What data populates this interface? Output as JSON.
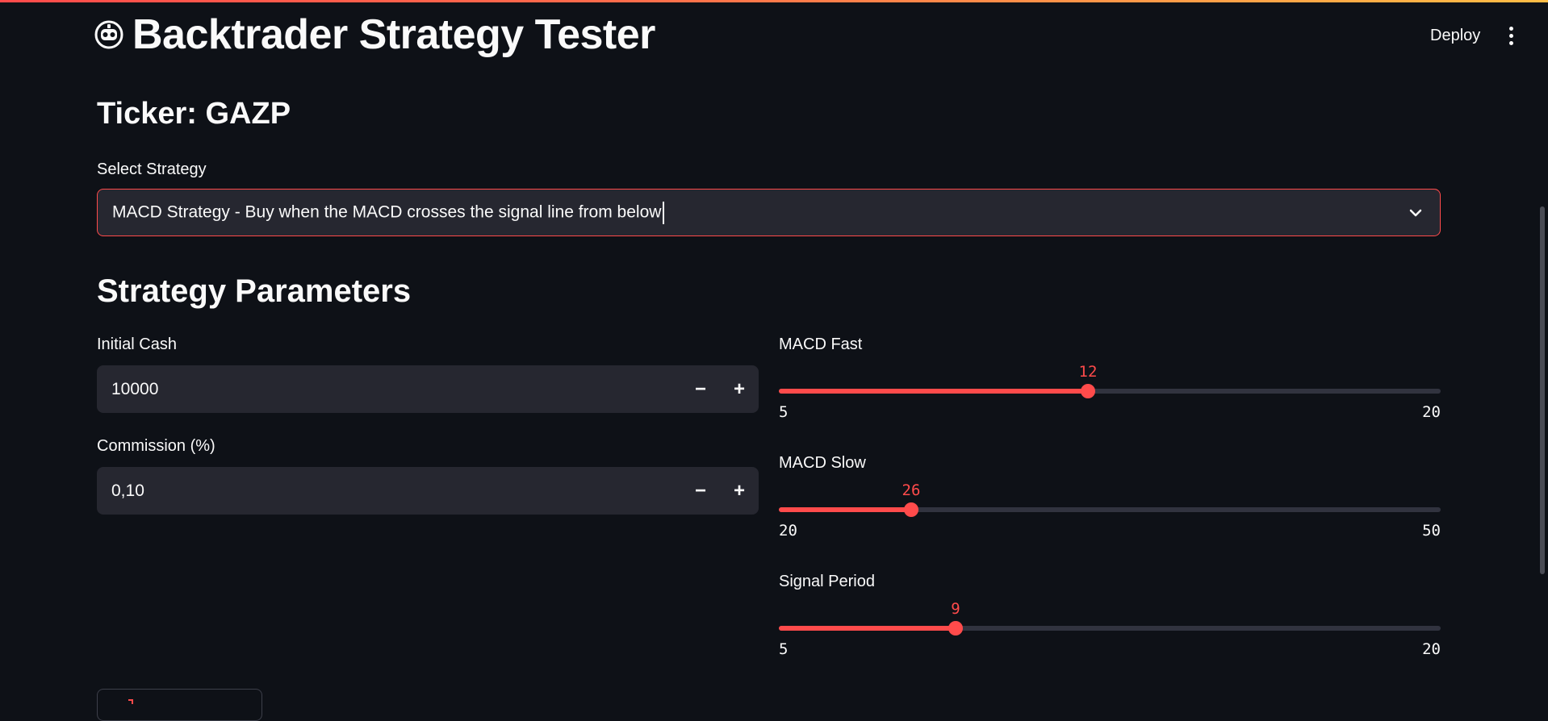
{
  "app": {
    "title": "Backtrader Strategy Tester",
    "icon": "robot-face-icon"
  },
  "header": {
    "deploy_label": "Deploy",
    "menu_icon": "vertical-ellipsis-icon"
  },
  "ticker": {
    "heading": "Ticker: GAZP"
  },
  "strategy_select": {
    "label": "Select Strategy",
    "value": "MACD Strategy - Buy when the MACD crosses the signal line from below",
    "icon": "chevron-down-icon"
  },
  "parameters": {
    "heading": "Strategy Parameters",
    "initial_cash": {
      "label": "Initial Cash",
      "value": "10000",
      "decrement": "−",
      "increment": "+"
    },
    "commission": {
      "label": "Commission (%)",
      "value": "0,10",
      "decrement": "−",
      "increment": "+"
    },
    "sliders": [
      {
        "label": "MACD Fast",
        "value": 12,
        "min": 5,
        "max": 20
      },
      {
        "label": "MACD Slow",
        "value": 26,
        "min": 20,
        "max": 50
      },
      {
        "label": "Signal Period",
        "value": 9,
        "min": 5,
        "max": 20
      }
    ]
  },
  "colors": {
    "accent": "#ff4b4b",
    "background": "#0e1117",
    "input_background": "#262730",
    "text": "#fafafa"
  }
}
